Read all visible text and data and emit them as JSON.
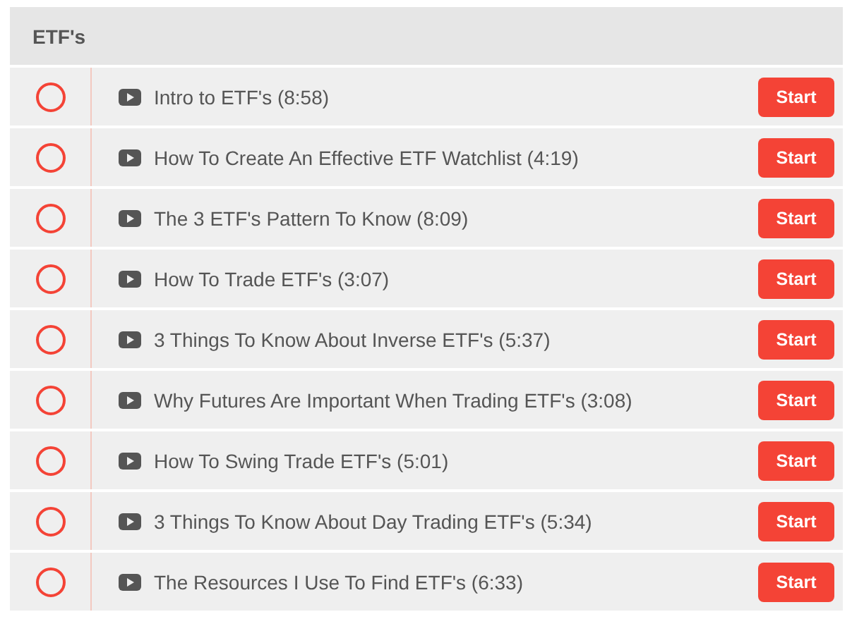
{
  "section": {
    "title": "ETF's"
  },
  "lessons": [
    {
      "title": "Intro to ETF's (8:58)",
      "completed": false,
      "button": "Start"
    },
    {
      "title": "How To Create An Effective ETF Watchlist (4:19)",
      "completed": false,
      "button": "Start"
    },
    {
      "title": "The 3 ETF's Pattern To Know (8:09)",
      "completed": false,
      "button": "Start"
    },
    {
      "title": "How To Trade ETF's (3:07)",
      "completed": false,
      "button": "Start"
    },
    {
      "title": "3 Things To Know About Inverse ETF's (5:37)",
      "completed": false,
      "button": "Start"
    },
    {
      "title": "Why Futures Are Important When Trading ETF's (3:08)",
      "completed": false,
      "button": "Start"
    },
    {
      "title": "How To Swing Trade ETF's (5:01)",
      "completed": false,
      "button": "Start"
    },
    {
      "title": "3 Things To Know About Day Trading ETF's (5:34)",
      "completed": false,
      "button": "Start"
    },
    {
      "title": "The Resources I Use To Find ETF's (6:33)",
      "completed": false,
      "button": "Start"
    }
  ]
}
